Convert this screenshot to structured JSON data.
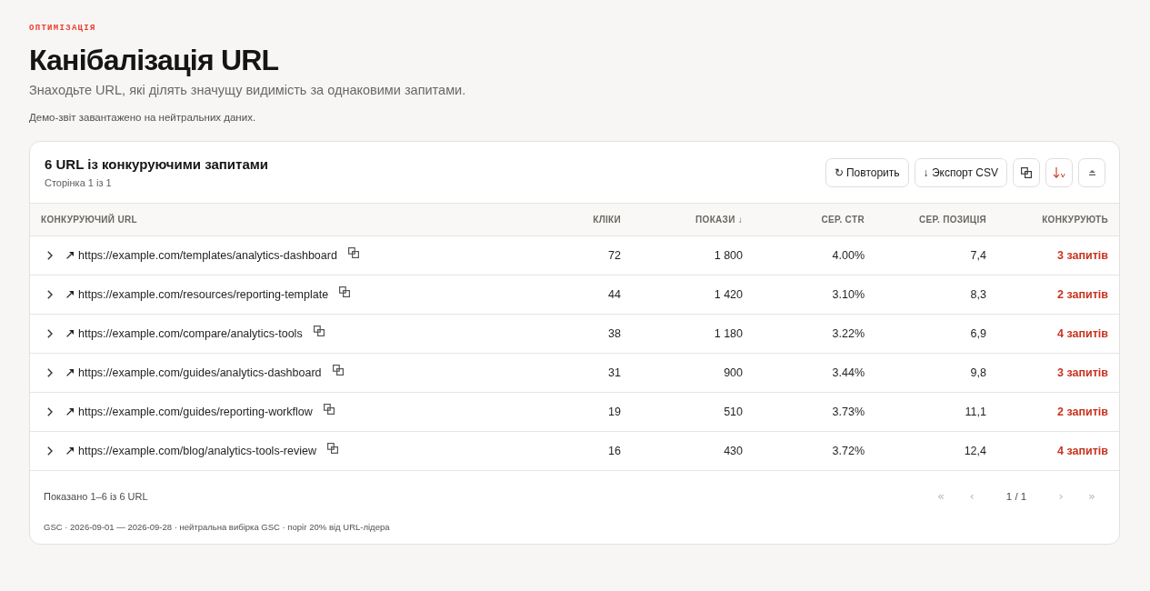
{
  "header": {
    "eyebrow": "ОПТИМІЗАЦІЯ",
    "title": "Канібалізація URL",
    "subtitle": "Знаходьте URL, які ділять значущу видимість за однаковими запитами.",
    "note": "Демо-звіт завантажено на нейтральних даних."
  },
  "card": {
    "title": "6 URL із конкуруючими запитами",
    "subtitle": "Сторінка 1 із 1",
    "toolbar": [
      {
        "kind": "text",
        "label": "↻ Повторить"
      },
      {
        "kind": "text",
        "label": "↓ Экспорт CSV"
      },
      {
        "kind": "copy"
      },
      {
        "kind": "sort"
      },
      {
        "kind": "collapse"
      }
    ]
  },
  "table": {
    "columns": [
      {
        "label": "КОНКУРУЮЧИЙ URL",
        "kind": "url"
      },
      {
        "label": "КЛІКИ",
        "kind": "number"
      },
      {
        "label": "ПОКАЗИ ↓",
        "kind": "number"
      },
      {
        "label": "СЕР. CTR",
        "kind": "number"
      },
      {
        "label": "СЕР. ПОЗИЦІЯ",
        "kind": "number"
      },
      {
        "label": "КОНКУРУЮТЬ",
        "kind": "count"
      }
    ],
    "rows": [
      {
        "expanded": false,
        "cells": [
          "https://example.com/templates/analytics-dashboard",
          "72",
          "1 800",
          "4.00%",
          "7,4",
          "3 запитів"
        ]
      },
      {
        "expanded": false,
        "cells": [
          "https://example.com/resources/reporting-template",
          "44",
          "1 420",
          "3.10%",
          "8,3",
          "2 запитів"
        ]
      },
      {
        "expanded": false,
        "cells": [
          "https://example.com/compare/analytics-tools",
          "38",
          "1 180",
          "3.22%",
          "6,9",
          "4 запитів"
        ]
      },
      {
        "expanded": false,
        "cells": [
          "https://example.com/guides/analytics-dashboard",
          "31",
          "900",
          "3.44%",
          "9,8",
          "3 запитів"
        ]
      },
      {
        "expanded": false,
        "cells": [
          "https://example.com/guides/reporting-workflow",
          "19",
          "510",
          "3.73%",
          "11,1",
          "2 запитів"
        ]
      },
      {
        "expanded": false,
        "cells": [
          "https://example.com/blog/analytics-tools-review",
          "16",
          "430",
          "3.72%",
          "12,4",
          "4 запитів"
        ]
      }
    ]
  },
  "footer": {
    "summary": "Показано 1–6 із 6 URL",
    "pagination": [
      {
        "kind": "nav",
        "label": "«",
        "disabled": true
      },
      {
        "kind": "nav",
        "label": "‹",
        "disabled": true
      },
      {
        "kind": "page",
        "label": "1 / 1",
        "disabled": false
      },
      {
        "kind": "nav",
        "label": "›",
        "disabled": true
      },
      {
        "kind": "nav",
        "label": "»",
        "disabled": true
      }
    ],
    "source": "GSC · 2026-09-01 — 2026-09-28 · нейтральна вибірка GSC · поріг 20% від URL-лідера"
  }
}
